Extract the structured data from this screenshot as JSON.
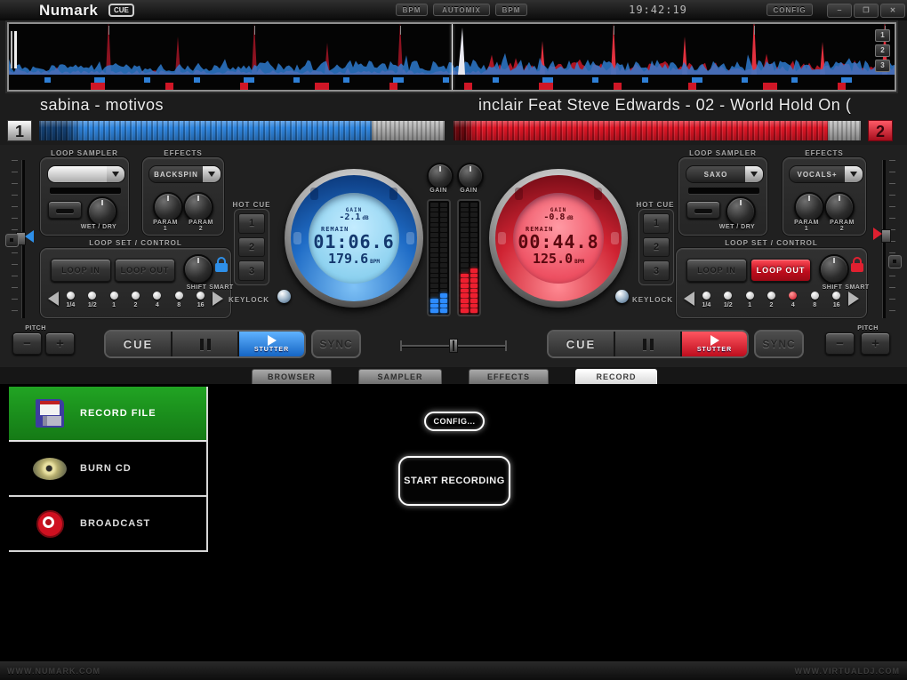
{
  "topbar": {
    "logo": "Numark",
    "logo_badge": "CUE",
    "bpm_left": "BPM",
    "automix": "AUTOMIX",
    "bpm_right": "BPM",
    "clock": "19:42:19",
    "config": "CONFIG",
    "minimize": "‒",
    "maximize": "❐",
    "close": "✕"
  },
  "rhythm": {
    "zoom_levels": [
      "1",
      "2",
      "3"
    ]
  },
  "labels": {
    "loop_sampler": "LOOP SAMPLER",
    "effects": "EFFECTS",
    "wet_dry": "WET / DRY",
    "param": "PARAM",
    "loop_set": "LOOP SET / CONTROL",
    "loop_in": "LOOP IN",
    "loop_out": "LOOP OUT",
    "shift": "SHIFT",
    "smart": "SMART",
    "hot_cue": "HOT CUE",
    "keylock": "KEYLOCK",
    "gain": "GAIN",
    "remain": "REMAIN",
    "bpm_unit": "BPM",
    "db_unit": "dB",
    "pitch": "PITCH",
    "minus": "−",
    "plus": "+",
    "cue": "CUE",
    "stutter": "STUTTER",
    "sync": "SYNC",
    "one": "1",
    "two": "2",
    "three": "3",
    "fractions": [
      "1/4",
      "1/2",
      "1",
      "2",
      "4",
      "8",
      "16"
    ]
  },
  "deck1": {
    "number": "1",
    "title": "sabina - motivos",
    "sampler_value": "",
    "effect_value": "BACKSPIN",
    "gain_db": "-2.1",
    "remain_time": "01:06.6",
    "bpm": "179.6",
    "progress_pct": 82,
    "active_fraction": -1
  },
  "deck2": {
    "number": "2",
    "title": "inclair Feat Steve Edwards - 02 - World Hold On (",
    "sampler_value": "SAXO",
    "effect_value": "VOCALS+",
    "gain_db": "-0.8",
    "remain_time": "00:44.8",
    "bpm": "125.0",
    "progress_pct": 92,
    "active_fraction": 4
  },
  "meters": {
    "segments": 22,
    "left_lit": 3,
    "right_lit": 8
  },
  "tabs": [
    {
      "label": "BROWSER",
      "active": false
    },
    {
      "label": "SAMPLER",
      "active": false
    },
    {
      "label": "EFFECTS",
      "active": false
    },
    {
      "label": "RECORD",
      "active": true
    }
  ],
  "record": {
    "menu": [
      {
        "label": "RECORD FILE",
        "icon": "floppy-icon",
        "active": true
      },
      {
        "label": "BURN CD",
        "icon": "cd-icon",
        "active": false
      },
      {
        "label": "BROADCAST",
        "icon": "broadcast-icon",
        "active": false
      }
    ],
    "config_button": "CONFIG...",
    "start_button": "START RECORDING"
  },
  "footer": {
    "left": "WWW.NUMARK.COM",
    "right": "WWW.VIRTUALDJ.COM"
  },
  "colors": {
    "blue": "#2f86e0",
    "red": "#d8202f",
    "green": "#1e9421"
  }
}
